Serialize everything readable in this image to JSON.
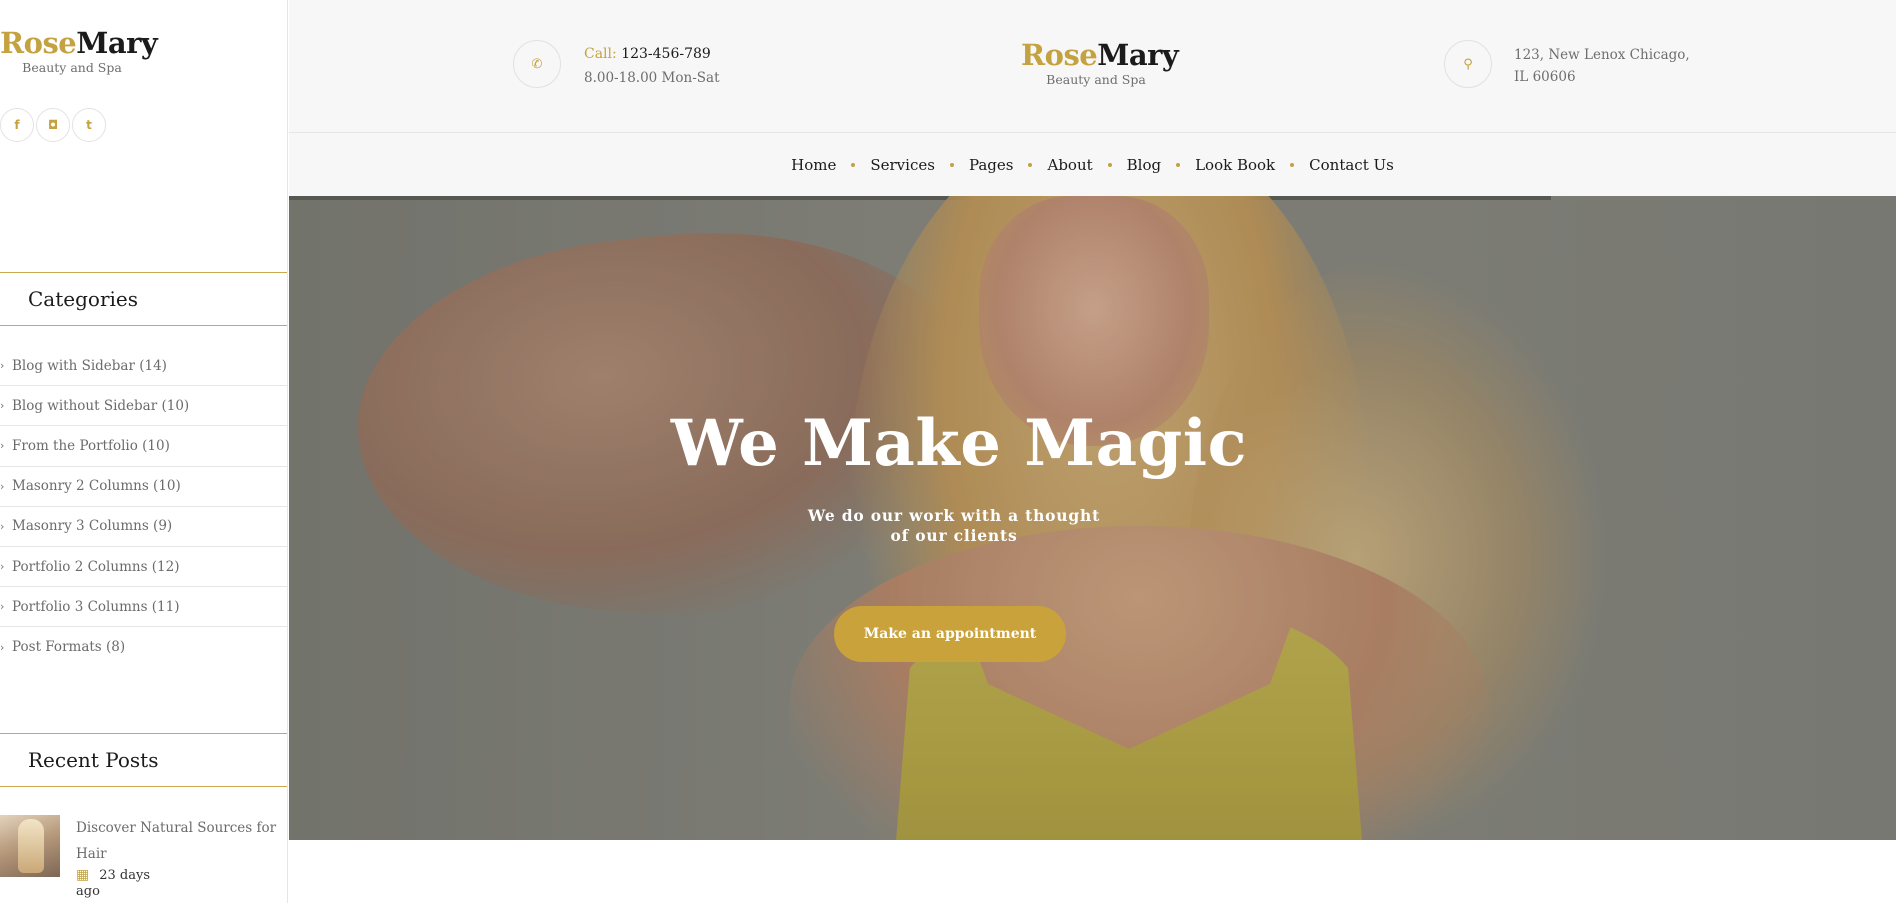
{
  "brand": {
    "rose": "Rose",
    "mary": "Mary",
    "tagline": "Beauty and Spa",
    "accent": "#c5a240"
  },
  "sidebar": {
    "socials": [
      {
        "icon": "facebook-icon",
        "glyph": "f"
      },
      {
        "icon": "instagram-icon",
        "glyph": "◘"
      },
      {
        "icon": "tumblr-icon",
        "glyph": "t"
      }
    ],
    "categories_title": "Categories",
    "categories": [
      "Blog with Sidebar (14)",
      "Blog without Sidebar (10)",
      "From the Portfolio (10)",
      "Masonry 2 Columns (10)",
      "Masonry 3 Columns (9)",
      "Portfolio 2 Columns (12)",
      "Portfolio 3 Columns (11)",
      "Post Formats (8)"
    ],
    "recent_title": "Recent Posts",
    "recent_posts": [
      {
        "title": "Discover Natural Sources for Hair",
        "date": "23 days ago"
      }
    ]
  },
  "header": {
    "call_label": "Call:",
    "phone": "123-456-789",
    "hours": "8.00-18.00 Mon-Sat",
    "address_line1": "123, New Lenox Chicago,",
    "address_line2": "IL 60606"
  },
  "nav": [
    "Home",
    "Services",
    "Pages",
    "About",
    "Blog",
    "Look Book",
    "Contact Us"
  ],
  "hero": {
    "title": "We Make Magic",
    "subtitle_line1": "We do our work with a thought",
    "subtitle_line2": "of our clients",
    "cta": "Make an appointment"
  }
}
